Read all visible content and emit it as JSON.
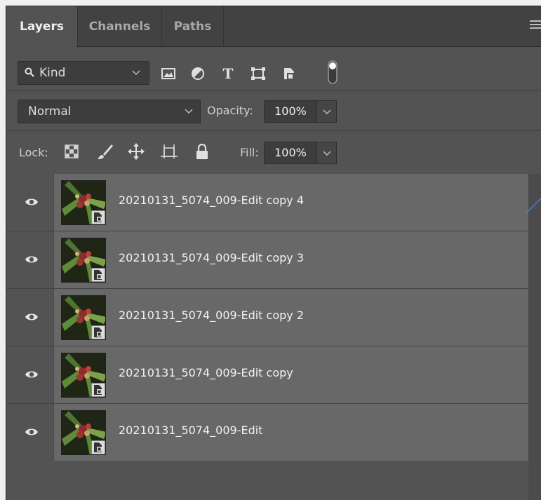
{
  "tabs": {
    "layers": "Layers",
    "channels": "Channels",
    "paths": "Paths"
  },
  "filter": {
    "kind_label": "Kind",
    "icons": [
      "image-filter-icon",
      "adjustment-filter-icon",
      "type-filter-icon",
      "shape-filter-icon",
      "smart-object-filter-icon",
      "filter-toggle-icon"
    ]
  },
  "blend": {
    "mode": "Normal",
    "opacity_label": "Opacity:",
    "opacity_value": "100%"
  },
  "lock": {
    "label": "Lock:",
    "fill_label": "Fill:",
    "fill_value": "100%",
    "icons": [
      "lock-transparent-pixels-icon",
      "lock-image-pixels-icon",
      "lock-position-icon",
      "lock-artboard-icon",
      "lock-all-icon"
    ]
  },
  "layers": [
    {
      "name": "20210131_5074_009-Edit copy 4",
      "visible": true
    },
    {
      "name": "20210131_5074_009-Edit copy 3",
      "visible": true
    },
    {
      "name": "20210131_5074_009-Edit copy 2",
      "visible": true
    },
    {
      "name": "20210131_5074_009-Edit copy",
      "visible": true
    },
    {
      "name": "20210131_5074_009-Edit",
      "visible": true
    }
  ],
  "colors": {
    "panel_bg": "#535353",
    "tabbar_bg": "#424242",
    "layer_row_bg": "#686868",
    "field_bg": "#3d3d3d",
    "text": "#f2f2f2"
  }
}
